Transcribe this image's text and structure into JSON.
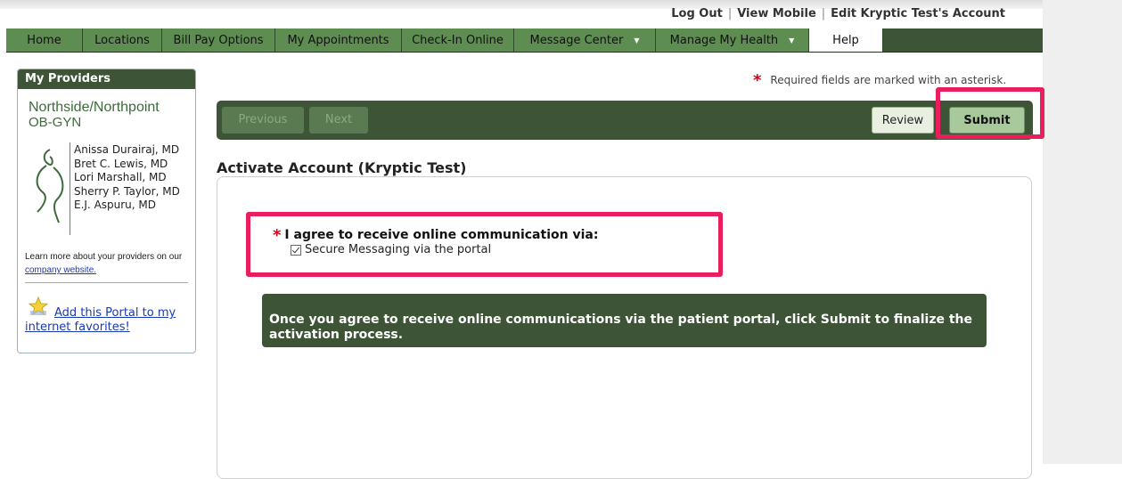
{
  "top_links": {
    "log_out": "Log Out",
    "view_mobile": "View Mobile",
    "edit_account": "Edit Kryptic Test's Account",
    "separator": "|"
  },
  "nav": {
    "items": [
      {
        "label": "Home"
      },
      {
        "label": "Locations"
      },
      {
        "label": "Bill Pay Options"
      },
      {
        "label": "My Appointments"
      },
      {
        "label": "Check-In Online"
      },
      {
        "label": "Message Center",
        "dropdown": true
      },
      {
        "label": "Manage My Health",
        "dropdown": true
      },
      {
        "label": "Help",
        "active": true
      }
    ]
  },
  "sidebar": {
    "header": "My Providers",
    "practice_name": "Northside/Northpoint",
    "practice_sub": "OB-GYN",
    "doctors": [
      "Anissa Durairaj, MD",
      "Bret C. Lewis, MD",
      "Lori Marshall, MD",
      "Sherry P. Taylor, MD",
      "E.J. Aspuru, MD"
    ],
    "learn_text": "Learn more about your providers on our",
    "learn_link": "company website.",
    "favorites_line1": "Add this Portal to my",
    "favorites_line2": "internet favorites!"
  },
  "required_note": {
    "asterisk": "*",
    "text": "Required fields are marked with an asterisk."
  },
  "toolbar": {
    "previous": "Previous",
    "next": "Next",
    "review": "Review",
    "submit": "Submit"
  },
  "page_title": "Activate Account (Kryptic Test)",
  "agreement": {
    "asterisk": "*",
    "label": "I agree to receive online communication via:",
    "option_label": "Secure Messaging via the portal",
    "checked": true
  },
  "info_message": "Once you agree to receive online communications via the patient portal, click Submit to finalize the activation process.",
  "colors": {
    "dark_green": "#3d5436",
    "nav_green": "#5d8d51",
    "highlight": "#ea1d5d",
    "required_red": "#d0021b"
  }
}
